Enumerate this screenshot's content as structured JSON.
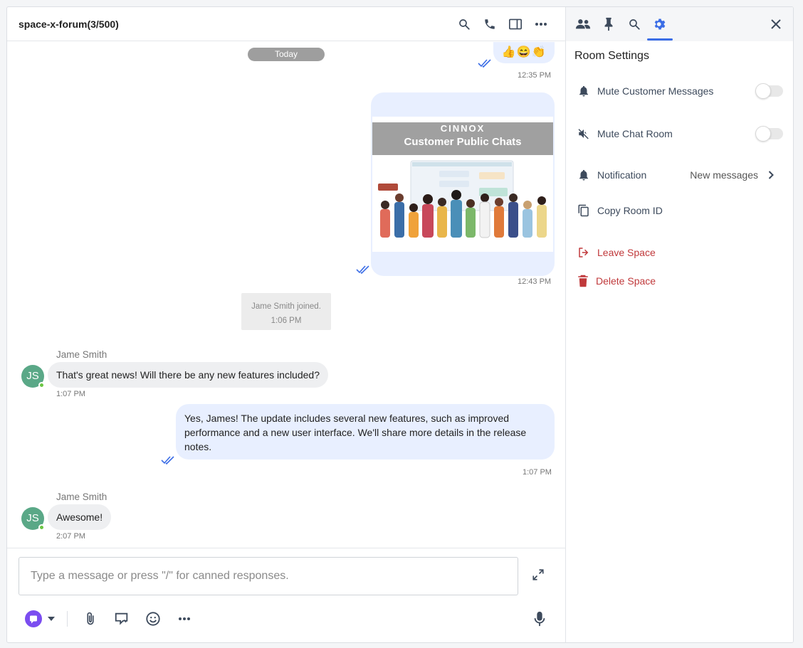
{
  "chat": {
    "title": "space-x-forum(3/500)",
    "date_divider": "Today",
    "emoji_reactions": "👍😄👏",
    "emoji_time": "12:35 PM",
    "image_message": {
      "banner_brand": "CINNOX",
      "banner_title": "Customer Public Chats",
      "time": "12:43 PM"
    },
    "system_note": {
      "text": "Jame Smith joined.",
      "time": "1:06 PM"
    },
    "messages": [
      {
        "sender": "Jame Smith",
        "initials": "JS",
        "text": "That's great news! Will there be any new features included?",
        "time": "1:07 PM"
      },
      {
        "sender": "me",
        "text": "Yes, James! The update includes several new features, such as improved performance and a new user interface. We'll share more details in the release notes.",
        "time": "1:07 PM"
      },
      {
        "sender": "Jame Smith",
        "initials": "JS",
        "text": "Awesome!",
        "time": "2:07 PM"
      }
    ]
  },
  "composer": {
    "placeholder": "Type a message or press \"/\" for canned responses."
  },
  "settings": {
    "title": "Room Settings",
    "rows": [
      {
        "label": "Mute Customer Messages",
        "toggle": false
      },
      {
        "label": "Mute Chat Room",
        "toggle": false
      },
      {
        "label": "Notification",
        "value": "New messages"
      },
      {
        "label": "Copy Room ID"
      },
      {
        "label": "Leave Space"
      },
      {
        "label": "Delete Space"
      }
    ]
  },
  "colors": {
    "accent": "#3b6de6",
    "outgoing_bubble": "#e8efff",
    "incoming_bubble": "#eeeff1",
    "avatar": "#5aa887",
    "danger": "#c0393b",
    "online": "#6cc644"
  }
}
